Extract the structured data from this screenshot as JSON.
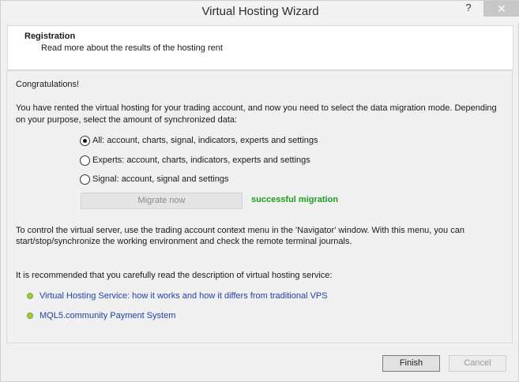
{
  "window": {
    "title": "Virtual Hosting Wizard",
    "help_glyph": "?",
    "close_glyph": "✕"
  },
  "header": {
    "title": "Registration",
    "subtitle": "Read more about the results of the hosting rent"
  },
  "content": {
    "congrats": "Congratulations!",
    "intro_line1": "You have rented the virtual hosting for your trading account, and now you need to select the data migration mode. Depending",
    "intro_line2": "on your purpose, select the amount of synchronized data:",
    "options": [
      {
        "label": "All: account, charts, signal, indicators, experts and settings",
        "checked": true
      },
      {
        "label": "Experts: account, charts, indicators, experts and settings",
        "checked": false
      },
      {
        "label": "Signal: account, signal and settings",
        "checked": false
      }
    ],
    "migrate_button": "Migrate now",
    "status": "successful migration",
    "control_line1": "To control the virtual server, use the trading account context menu in the 'Navigator' window. With this menu, you can",
    "control_line2": "start/stop/synchronize the working environment and check the remote terminal journals.",
    "recommend": "It is recommended that you carefully read the description of virtual hosting service:",
    "links": [
      "Virtual Hosting Service: how it works and how it differs from traditional VPS",
      "MQL5.community Payment System"
    ]
  },
  "footer": {
    "finish": "Finish",
    "cancel": "Cancel"
  }
}
